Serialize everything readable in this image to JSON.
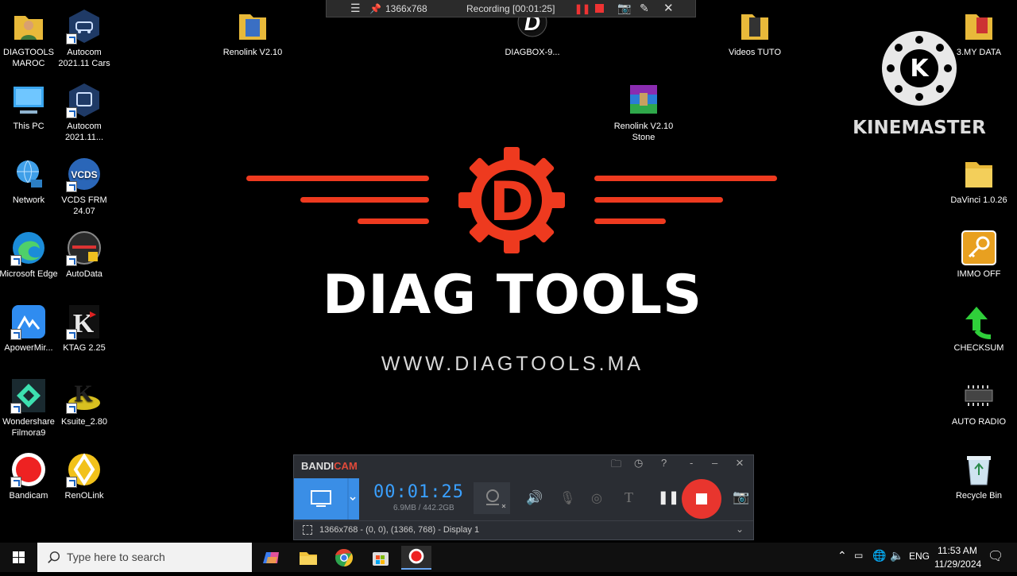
{
  "desktop": {
    "icons_left": [
      {
        "label": "DIAGTOOLS MAROC"
      },
      {
        "label": "Autocom 2021.11 Cars"
      },
      {
        "label": "This PC"
      },
      {
        "label": "Autocom 2021.11..."
      },
      {
        "label": "Network"
      },
      {
        "label": "VCDS FRM 24.07"
      },
      {
        "label": "Microsoft Edge"
      },
      {
        "label": "AutoData"
      },
      {
        "label": "ApowerMir..."
      },
      {
        "label": "KTAG 2.25"
      },
      {
        "label": "Wondershare Filmora9"
      },
      {
        "label": "Ksuite_2.80"
      },
      {
        "label": "Bandicam"
      },
      {
        "label": "RenOLink"
      }
    ],
    "icons_middle": [
      {
        "label": "Renolink V2.10"
      },
      {
        "label": "DIAGBOX-9..."
      },
      {
        "label": "Renolink V2.10 Stone"
      },
      {
        "label": "Videos TUTO"
      }
    ],
    "icons_right": [
      {
        "label": "3.MY DATA"
      },
      {
        "label": "DaVinci 1.0.26"
      },
      {
        "label": "IMMO OFF"
      },
      {
        "label": "CHECKSUM"
      },
      {
        "label": "AUTO RADIO"
      },
      {
        "label": "Recycle Bin"
      }
    ],
    "wallpaper": {
      "brand_title": "DIAG TOOLS",
      "brand_url": "WWW.DIAGTOOLS.MA",
      "logo_letter": "D",
      "accent_color": "#ee3a1f"
    },
    "kinemaster": {
      "text": "KINEMASTER",
      "logo_letter": "K"
    }
  },
  "recording_bar": {
    "resolution": "1366x768",
    "status": "Recording [00:01:25]"
  },
  "bandicam": {
    "brand_a": "BANDI",
    "brand_b": "CAM",
    "timer": "00:01:25",
    "size": "6.9MB / 442.2GB",
    "footer": "1366x768 - (0, 0), (1366, 768) - Display 1",
    "help": "?",
    "minimize_a": "-",
    "minimize_b": "–",
    "close": "×",
    "text_tool": "T"
  },
  "taskbar": {
    "search_placeholder": "Type here to search",
    "language": "ENG",
    "time": "11:53 AM",
    "date": "11/29/2024"
  }
}
